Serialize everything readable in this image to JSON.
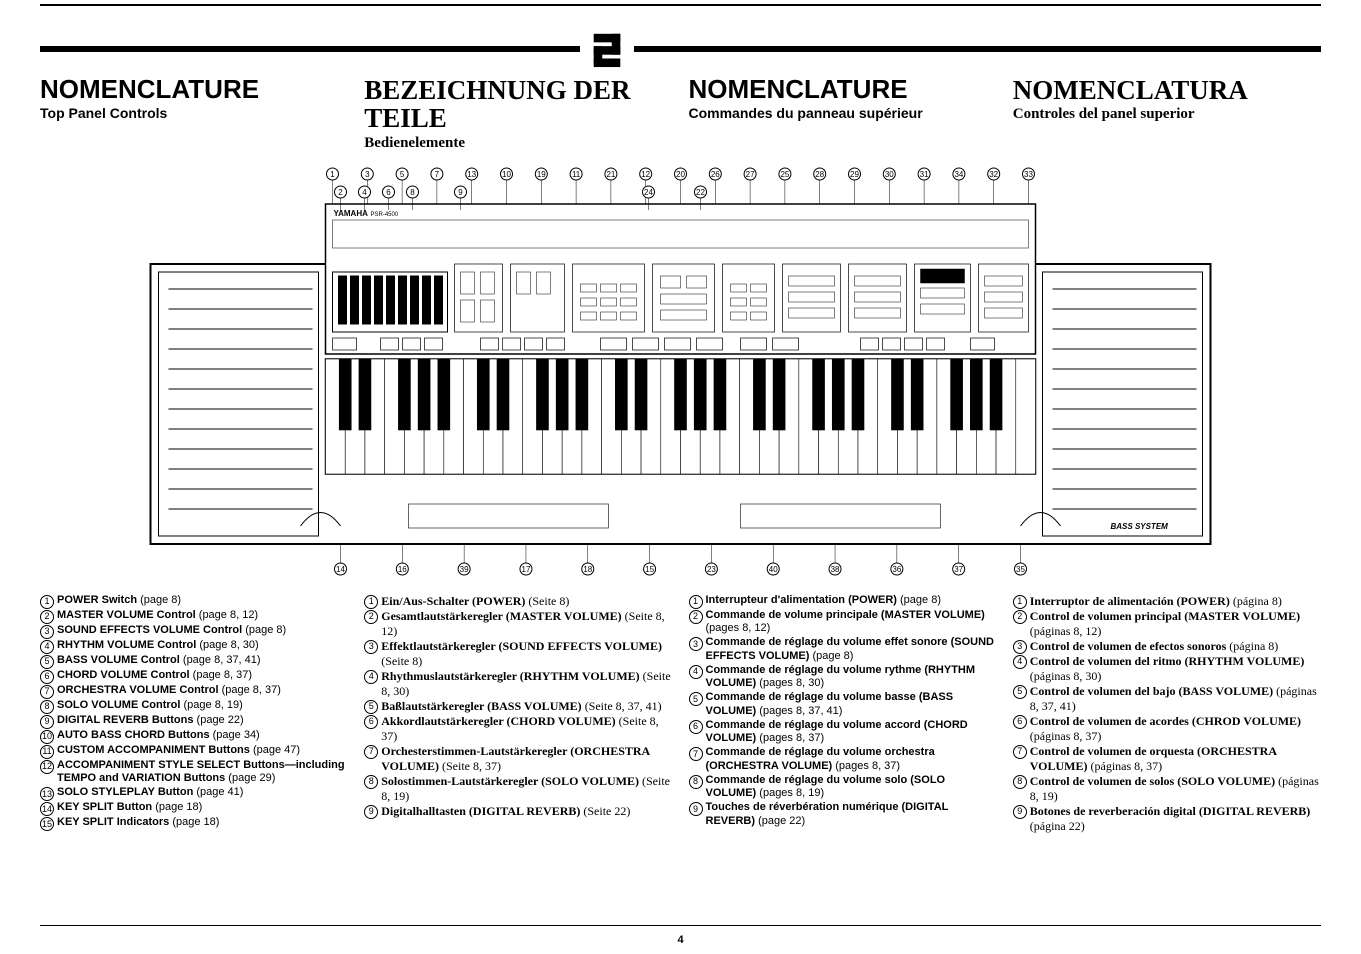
{
  "page_number": "4",
  "section_number": "2",
  "headers": {
    "en": {
      "title": "NOMENCLATURE",
      "sub": "Top Panel Controls"
    },
    "de": {
      "title": "BEZEICHNUNG DER TEILE",
      "sub": "Bedienelemente"
    },
    "fr": {
      "title": "NOMENCLATURE",
      "sub": "Commandes du panneau supérieur"
    },
    "es": {
      "title": "NOMENCLATURA",
      "sub": "Controles del panel superior"
    }
  },
  "keyboard": {
    "brand": "YAMAHA",
    "model": "PSR-4500",
    "speaker_logo": "BASS SYSTEM",
    "top_callouts": [
      "1",
      "3",
      "5",
      "7",
      "13",
      "10",
      "19",
      "11",
      "21",
      "12",
      "20",
      "26",
      "27",
      "25",
      "28",
      "29",
      "30",
      "31",
      "34",
      "32",
      "33"
    ],
    "top_callouts_row2": [
      "2",
      "4",
      "6",
      "8",
      "9",
      "24",
      "22"
    ],
    "bottom_callouts": [
      "14",
      "16",
      "39",
      "17",
      "18",
      "15",
      "23",
      "40",
      "38",
      "36",
      "37",
      "35"
    ]
  },
  "lists": {
    "en": [
      {
        "n": "1",
        "bold": "POWER Switch",
        "rest": " (page 8)"
      },
      {
        "n": "2",
        "bold": "MASTER VOLUME Control",
        "rest": " (page 8, 12)"
      },
      {
        "n": "3",
        "bold": "SOUND EFFECTS VOLUME Control",
        "rest": " (page 8)"
      },
      {
        "n": "4",
        "bold": "RHYTHM VOLUME Control",
        "rest": " (page 8, 30)"
      },
      {
        "n": "5",
        "bold": "BASS VOLUME Control",
        "rest": " (page 8, 37, 41)"
      },
      {
        "n": "6",
        "bold": "CHORD VOLUME Control",
        "rest": " (page 8, 37)"
      },
      {
        "n": "7",
        "bold": "ORCHESTRA VOLUME Control",
        "rest": " (page 8, 37)"
      },
      {
        "n": "8",
        "bold": "SOLO VOLUME Control",
        "rest": " (page 8, 19)"
      },
      {
        "n": "9",
        "bold": "DIGITAL REVERB Buttons",
        "rest": " (page 22)"
      },
      {
        "n": "10",
        "bold": "AUTO BASS CHORD Buttons",
        "rest": " (page 34)"
      },
      {
        "n": "11",
        "bold": "CUSTOM ACCOMPANIMENT Buttons",
        "rest": " (page 47)"
      },
      {
        "n": "12",
        "bold": "ACCOMPANIMENT STYLE SELECT Buttons—including TEMPO and VARIATION Buttons",
        "rest": " (page 29)"
      },
      {
        "n": "13",
        "bold": "SOLO STYLEPLAY Button",
        "rest": " (page 41)"
      },
      {
        "n": "14",
        "bold": "KEY SPLIT Button",
        "rest": " (page 18)"
      },
      {
        "n": "15",
        "bold": "KEY SPLIT Indicators",
        "rest": " (page 18)"
      }
    ],
    "de": [
      {
        "n": "1",
        "bold": "Ein/Aus-Schalter (POWER)",
        "rest": " (Seite 8)"
      },
      {
        "n": "2",
        "bold": "Gesamtlautstärkeregler (MASTER VOLUME)",
        "rest": " (Seite 8, 12)"
      },
      {
        "n": "3",
        "bold": "Effektlautstärkeregler (SOUND EFFECTS VOLUME)",
        "rest": " (Seite 8)"
      },
      {
        "n": "4",
        "bold": "Rhythmuslautstärkeregler (RHYTHM VOLUME)",
        "rest": " (Seite 8, 30)"
      },
      {
        "n": "5",
        "bold": "Baßlautstärkeregler (BASS VOLUME)",
        "rest": " (Seite 8, 37, 41)"
      },
      {
        "n": "6",
        "bold": "Akkordlautstärkeregler (CHORD VOLUME)",
        "rest": " (Seite 8, 37)"
      },
      {
        "n": "7",
        "bold": "Orchesterstimmen-Lautstärkeregler (ORCHESTRA VOLUME)",
        "rest": " (Seite 8, 37)"
      },
      {
        "n": "8",
        "bold": "Solostimmen-Lautstärkeregler (SOLO VOLUME)",
        "rest": " (Seite 8, 19)"
      },
      {
        "n": "9",
        "bold": "Digitalhalltasten (DIGITAL REVERB)",
        "rest": " (Seite 22)"
      }
    ],
    "fr": [
      {
        "n": "1",
        "bold": "Interrupteur d'alimentation (POWER)",
        "rest": " (page 8)"
      },
      {
        "n": "2",
        "bold": "Commande de volume principale (MASTER VOLUME)",
        "rest": " (pages 8, 12)"
      },
      {
        "n": "3",
        "bold": "Commande de réglage du volume effet sonore (SOUND EFFECTS VOLUME)",
        "rest": " (page 8)"
      },
      {
        "n": "4",
        "bold": "Commande de réglage du volume rythme (RHYTHM VOLUME)",
        "rest": " (pages 8, 30)"
      },
      {
        "n": "5",
        "bold": "Commande de réglage du volume basse (BASS VOLUME)",
        "rest": " (pages 8, 37, 41)"
      },
      {
        "n": "6",
        "bold": "Commande de réglage du volume accord (CHORD VOLUME)",
        "rest": " (pages 8, 37)"
      },
      {
        "n": "7",
        "bold": "Commande de réglage du volume orchestra (ORCHESTRA VOLUME)",
        "rest": " (pages 8, 37)"
      },
      {
        "n": "8",
        "bold": "Commande de réglage du volume solo (SOLO VOLUME)",
        "rest": " (pages 8, 19)"
      },
      {
        "n": "9",
        "bold": "Touches de réverbération numérique (DIGITAL REVERB)",
        "rest": " (page 22)"
      }
    ],
    "es": [
      {
        "n": "1",
        "bold": "Interruptor de alimentación (POWER)",
        "rest": " (página 8)"
      },
      {
        "n": "2",
        "bold": "Control de volumen principal (MASTER VOLUME)",
        "rest": " (páginas 8, 12)"
      },
      {
        "n": "3",
        "bold": "Control de volumen de efectos sonoros",
        "rest": " (página 8)"
      },
      {
        "n": "4",
        "bold": "Control de volumen del ritmo (RHYTHM VOLUME)",
        "rest": " (páginas 8, 30)"
      },
      {
        "n": "5",
        "bold": "Control de volumen del bajo (BASS VOLUME)",
        "rest": " (páginas 8, 37, 41)"
      },
      {
        "n": "6",
        "bold": "Control de volumen de acordes (CHROD VOLUME)",
        "rest": " (páginas 8, 37)"
      },
      {
        "n": "7",
        "bold": "Control de volumen de orquesta (ORCHESTRA VOLUME)",
        "rest": " (páginas 8, 37)"
      },
      {
        "n": "8",
        "bold": "Control de volumen de solos (SOLO VOLUME)",
        "rest": " (páginas 8, 19)"
      },
      {
        "n": "9",
        "bold": "Botones de reverberación digital (DIGITAL REVERB)",
        "rest": " (página 22)"
      }
    ]
  }
}
